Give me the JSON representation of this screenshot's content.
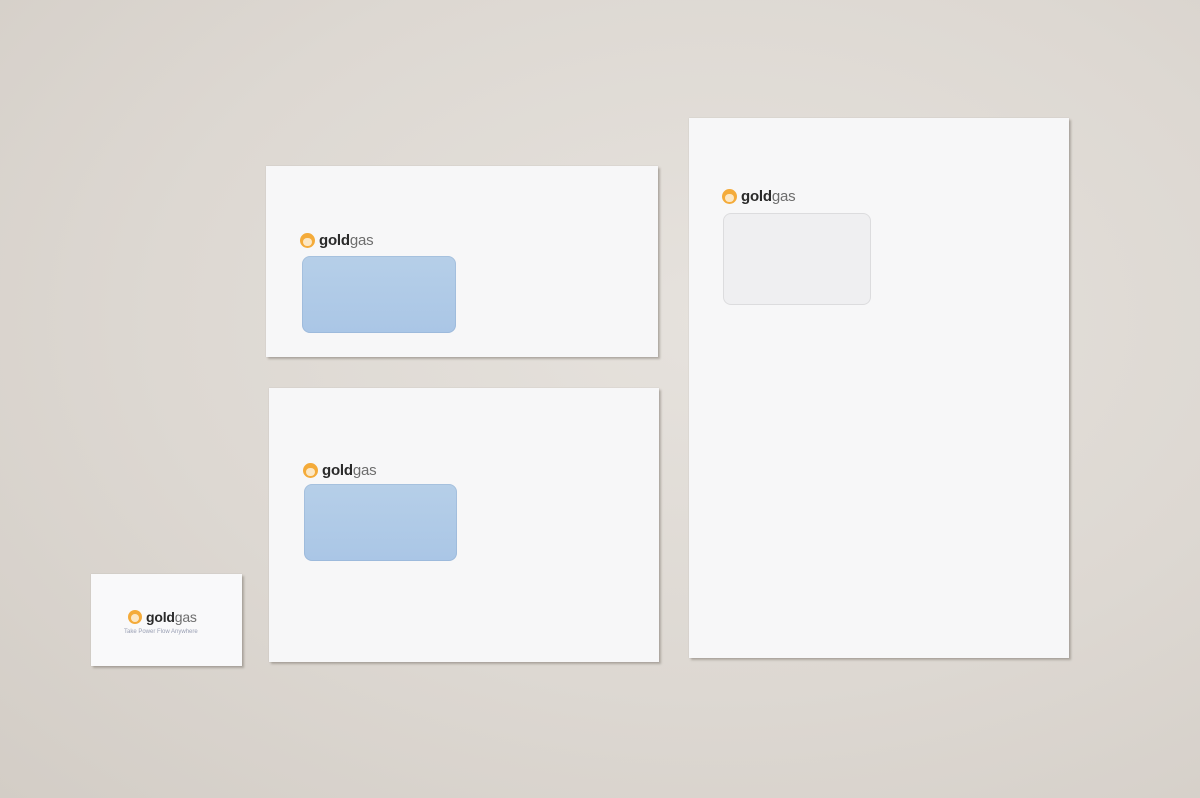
{
  "brand": {
    "bold_part": "gold",
    "light_part": "gas",
    "accent_color": "#f4ab3a"
  },
  "items": {
    "dl_envelope": {
      "window_color": "#aac6e6"
    },
    "c5_envelope": {
      "window_color": "#aac6e6"
    },
    "c4_envelope": {
      "window_color": "#efeff1"
    },
    "business_card": {
      "tagline": "Take Power Flow Anywhere"
    }
  },
  "icons": {
    "logo": "flame-circle-icon"
  }
}
